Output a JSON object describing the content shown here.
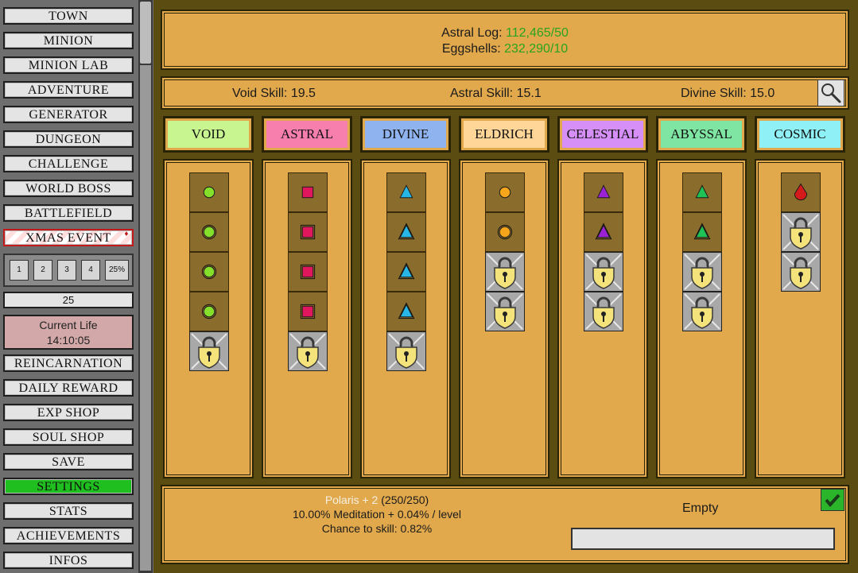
{
  "sidebar": {
    "nav": [
      "TOWN",
      "MINION",
      "MINION LAB",
      "ADVENTURE",
      "GENERATOR",
      "DUNGEON",
      "CHALLENGE",
      "WORLD BOSS",
      "BATTLEFIELD",
      "XMAS EVENT"
    ],
    "ratio_buttons": [
      "1",
      "2",
      "3",
      "4",
      "25%"
    ],
    "amount": "25",
    "current_life_label": "Current Life",
    "current_life_time": "14:10:05",
    "nav2": [
      "REINCARNATION",
      "DAILY REWARD",
      "EXP SHOP",
      "SOUL SHOP",
      "SAVE",
      "SETTINGS",
      "STATS",
      "ACHIEVEMENTS",
      "INFOS"
    ]
  },
  "resources": {
    "astral_log_label": "Astral Log:",
    "astral_log_value": "112,465/50",
    "eggshells_label": "Eggshells:",
    "eggshells_value": "232,290/10"
  },
  "skills": {
    "void": "Void Skill: 19.5",
    "astral": "Astral Skill: 15.1",
    "divine": "Divine Skill: 15.0"
  },
  "colors": {
    "value_green": "#2aa41e",
    "settings_green": "#1fbf1f",
    "panel_gold": "#e1a94c"
  },
  "columns": [
    {
      "tab": "VOID",
      "color": "#c8f590",
      "icon_color": "#84e02a",
      "shape": "circle",
      "open": 4,
      "locked": 1
    },
    {
      "tab": "ASTRAL",
      "color": "#f77fae",
      "icon_color": "#e0175d",
      "shape": "square",
      "open": 4,
      "locked": 1
    },
    {
      "tab": "DIVINE",
      "color": "#8fb3ee",
      "icon_color": "#27b6e6",
      "shape": "triangle",
      "open": 4,
      "locked": 1
    },
    {
      "tab": "ELDRICH",
      "color": "#ffd697",
      "icon_color": "#f7a51b",
      "shape": "circle",
      "open": 2,
      "locked": 2
    },
    {
      "tab": "CELESTIAL",
      "color": "#d58ff7",
      "icon_color": "#9a22d4",
      "shape": "triangle",
      "open": 2,
      "locked": 2
    },
    {
      "tab": "ABYSSAL",
      "color": "#7fe5a2",
      "icon_color": "#1fc254",
      "shape": "triangle",
      "open": 2,
      "locked": 2
    },
    {
      "tab": "COSMIC",
      "color": "#8ff0f5",
      "icon_color": "#d41a1a",
      "shape": "drop",
      "open": 1,
      "locked": 2
    }
  ],
  "bottom": {
    "boost_name": "Polaris + 2",
    "boost_progress": "(250/250)",
    "boost_line2": "10.00% Meditation + 0.04% / level",
    "boost_line3": "Chance to skill: 0.82%",
    "queue_label": "Empty"
  },
  "icons": {
    "search": "magnifier-icon",
    "confirm": "checkmark-icon",
    "lock": "lock-icon",
    "xmas_bauble": "ornament-icon"
  }
}
